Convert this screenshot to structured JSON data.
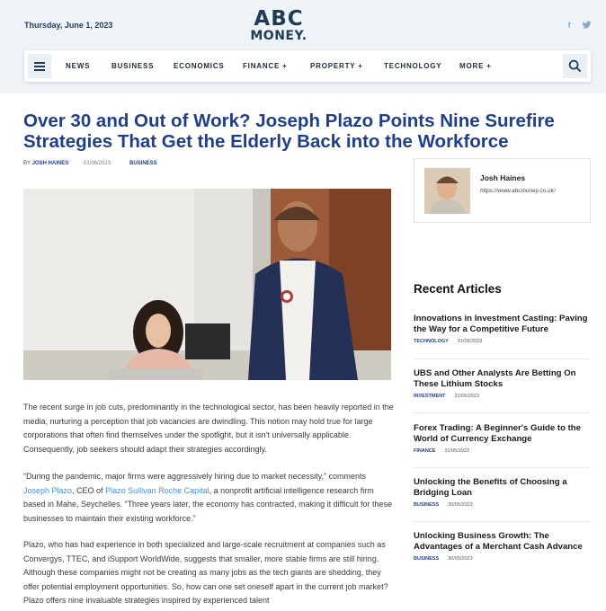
{
  "header": {
    "date": "Thursday, June 1, 2023",
    "logo_line1": "ABC",
    "logo_line2": "MONEY.",
    "social": [
      "f",
      "t"
    ]
  },
  "nav": {
    "items": [
      {
        "label": "NEWS"
      },
      {
        "label": "BUSINESS"
      },
      {
        "label": "ECONOMICS"
      },
      {
        "label": "FINANCE +"
      },
      {
        "label": "PROPERTY +"
      },
      {
        "label": "TECHNOLOGY"
      },
      {
        "label": "MORE +"
      }
    ],
    "menu_icon": "hamburger-menu-icon",
    "search_icon": "search-icon"
  },
  "article": {
    "title": "Over 30 and Out of Work? Joseph Plazo Points Nine Surefire Strategies That Get the Elderly Back into the Workforce",
    "by_label": "BY",
    "author": "JOSH HAINES",
    "date": "01/06/2023",
    "category": "BUSINESS",
    "p1": "The recent surge in job cuts, predominantly in the technological sector, has been heavily reported in the media, nurturing a perception that job vacancies are dwindling. This notion may hold true for large corporations that often find themselves under the spotlight, but it isn't universally applicable. Consequently, job seekers should adapt their strategies accordingly.",
    "p2_a": "“During the pandemic, major firms were aggressively hiring due to market necessity,” comments ",
    "p2_link1": "Joseph Plazo",
    "p2_b": ", CEO of ",
    "p2_link2": "Plazo Sullivan Roche Capital",
    "p2_c": ", a nonprofit artificial intelligence research firm based in Mahe, Seychelles. “Three years later, the economy has contracted, making it difficult for these businesses to maintain their existing workforce.”",
    "p3": "Plazo, who has had experience in both specialized and large-scale recruitment at companies such as Convergys, TTEC, and iSupport WorldWide, suggests that smaller, more stable firms are still hiring. Although these companies might not be creating as many jobs as the tech giants are shedding, they offer potential employment opportunities. So, how can one set oneself apart in the current job market? Plazo offers nine invaluable strategies inspired by experienced talent"
  },
  "author_card": {
    "name": "Josh Haines",
    "url": "https://www.abcmoney.co.uk/"
  },
  "sidebar": {
    "heading": "Recent Articles",
    "items": [
      {
        "title": "Innovations in Investment Casting: Paving the Way for a Competitive Future",
        "category": "TECHNOLOGY",
        "date": "01/06/2023"
      },
      {
        "title": "UBS and Other Analysts Are Betting On These Lithium Stocks",
        "category": "INVESTMENT",
        "date": "31/05/2023"
      },
      {
        "title": "Forex Trading: A Beginner's Guide to the World of Currency Exchange",
        "category": "FINANCE",
        "date": "31/05/2023"
      },
      {
        "title": "Unlocking the Benefits of Choosing a Bridging Loan",
        "category": "BUSINESS",
        "date": "30/05/2023"
      },
      {
        "title": "Unlocking Business Growth: The Advantages of a Merchant Cash Advance",
        "category": "BUSINESS",
        "date": "30/05/2023"
      }
    ]
  },
  "colors": {
    "brand_blue": "#1f3f8a",
    "link_blue": "#4a8fd0",
    "topbar_bg": "#eef3f7"
  }
}
